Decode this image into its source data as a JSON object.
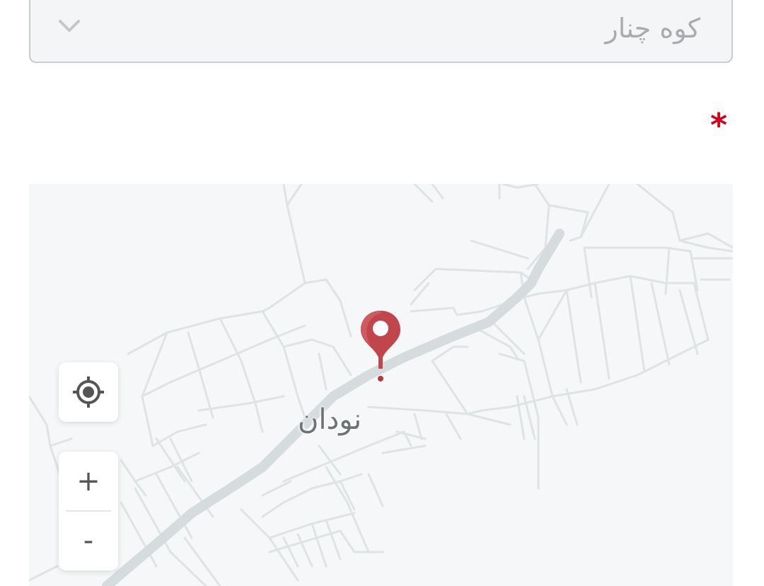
{
  "select": {
    "value": "کوه چنار",
    "chevron_icon": "chevron-down-icon"
  },
  "required_marker": "*",
  "map": {
    "place_label": "نودان",
    "pin_color": "#c0464b",
    "controls": {
      "locate_icon": "crosshair-icon",
      "zoom_in_label": "+",
      "zoom_out_label": "-"
    }
  }
}
